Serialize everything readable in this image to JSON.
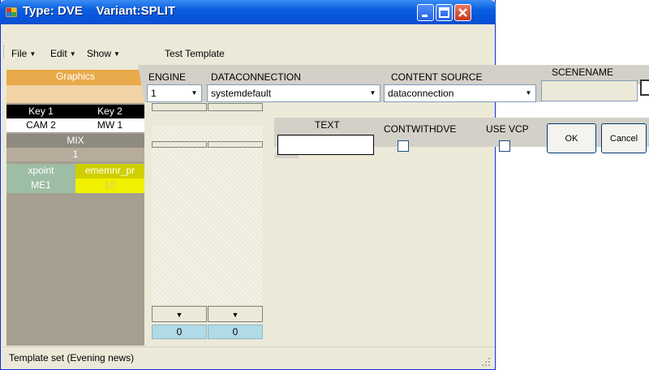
{
  "window": {
    "title": "Type: DVE    Variant:SPLIT"
  },
  "menu": {
    "file": "File",
    "edit": "Edit",
    "show": "Show",
    "test_template": "Test Template"
  },
  "left_panel": {
    "graphics_label": "Graphics",
    "key1": "Key 1",
    "key2": "Key 2",
    "cam2": "CAM 2",
    "mw1": "MW 1",
    "mix": "MIX",
    "mix_value": "1",
    "xpoint": "xpoint",
    "ememnr_pr": "ememnr_pr",
    "me1": "ME1",
    "ten": "10"
  },
  "ticket": {
    "engine_label": "ENGINE",
    "engine_value": "1",
    "dataconnection_label": "DATACONNECTION",
    "dataconnection_value": "systemdefault",
    "content_source_label": "CONTENT SOURCE",
    "content_source_value": "dataconnection",
    "scenename_label": "SCENENAME",
    "text_label": "TEXT",
    "contwithdve_label": "CONTWITHDVE",
    "use_vcp_label": "USE VCP",
    "ok_label": "OK",
    "cancel_label": "Cancel"
  },
  "columns": {
    "col1_value": "0",
    "col2_value": "0"
  },
  "status": {
    "text": "Template set (Evening news)"
  },
  "colors": {
    "title_bar": "#0a5fe0",
    "graphics_orange": "#e8aa4a",
    "yellow": "#e8e800",
    "teal": "#9dbda5",
    "cyan_cell": "#b0dae6"
  }
}
